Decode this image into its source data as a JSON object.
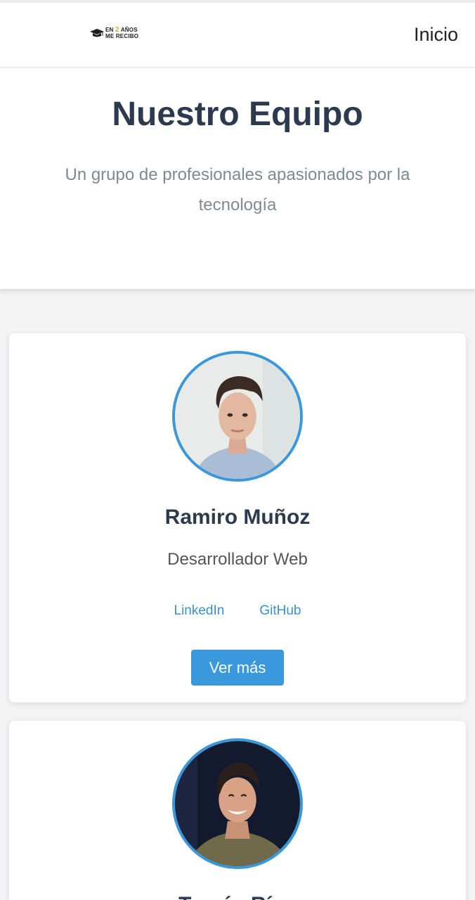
{
  "nav": {
    "logo_line1_a": "EN ",
    "logo_line1_num": "2",
    "logo_line1_b": " AÑOS",
    "logo_line2": "ME RECIBO",
    "link_label": "Inicio"
  },
  "hero": {
    "title": "Nuestro Equipo",
    "subtitle": "Un grupo de profesionales apasionados por la tecnología"
  },
  "team": [
    {
      "name": "Ramiro Muñoz",
      "role": "Desarrollador Web",
      "linkedin_label": "LinkedIn",
      "github_label": "GitHub",
      "button_label": "Ver más"
    },
    {
      "name": "Tomás Ríos"
    }
  ],
  "colors": {
    "accent": "#3a98dc",
    "title": "#2b3a4f",
    "subtitle": "#7d8a92",
    "page_bg": "#f3f3f4"
  }
}
